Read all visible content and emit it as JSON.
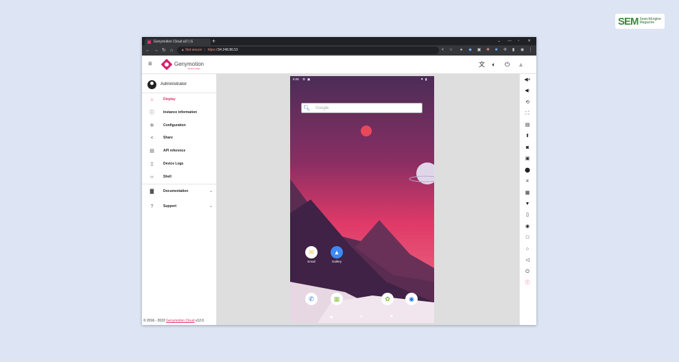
{
  "watermark": {
    "brand_big": "SEM",
    "brand_small_1": "SearchEngine",
    "brand_small_2": "Magazine"
  },
  "browser": {
    "tab_title": "Genymotion Cloud aO | G",
    "new_tab": "+",
    "win_min": "⌄",
    "win_restore": "—",
    "win_max": "▫",
    "win_close": "✕",
    "security_label": "Not secure",
    "separator": "|",
    "url_scheme": "https://",
    "url_host": "34.248.86.53"
  },
  "app": {
    "name": "Genymotion",
    "subtitle": "device image",
    "user_name": "Administrator",
    "nav_items": [
      {
        "label": "Display",
        "icon": "⌂",
        "active": true
      },
      {
        "label": "Instance information",
        "icon": "ⓘ"
      },
      {
        "label": "Configuration",
        "icon": "✲"
      },
      {
        "label": "Share",
        "icon": "<"
      },
      {
        "label": "API reference",
        "icon": "▤"
      },
      {
        "label": "Device Logs",
        "icon": "▯"
      },
      {
        "label": "Shell",
        "icon": "‹›"
      }
    ],
    "expandable_items": [
      {
        "label": "Documentation",
        "icon": "▇",
        "chevron": "⌄"
      },
      {
        "label": "Support",
        "icon": "?",
        "chevron": "⌄"
      }
    ],
    "footer": {
      "prefix": "© 2016 - 2022",
      "link": "Genymotion Cloud",
      "version": "v12.0"
    }
  },
  "device": {
    "time": "6:08",
    "search_placeholder": "Google",
    "apps": [
      {
        "label": "Email",
        "icon": "✉",
        "color": "#f5c242"
      },
      {
        "label": "Gallery",
        "icon": "▲",
        "color": "#3d8af7"
      }
    ],
    "dock": [
      {
        "icon": "✆",
        "color": "#1a73e8"
      },
      {
        "icon": "▦",
        "color": "#8bc34a"
      },
      {
        "icon": "✿",
        "color": "#7cb342"
      },
      {
        "icon": "◉",
        "color": "#1a73e8"
      }
    ],
    "nav_back": "◀",
    "nav_home": "●",
    "nav_recents": "■"
  },
  "colors": {
    "accent": "#e0306a",
    "page_bg": "#dde5f4"
  }
}
